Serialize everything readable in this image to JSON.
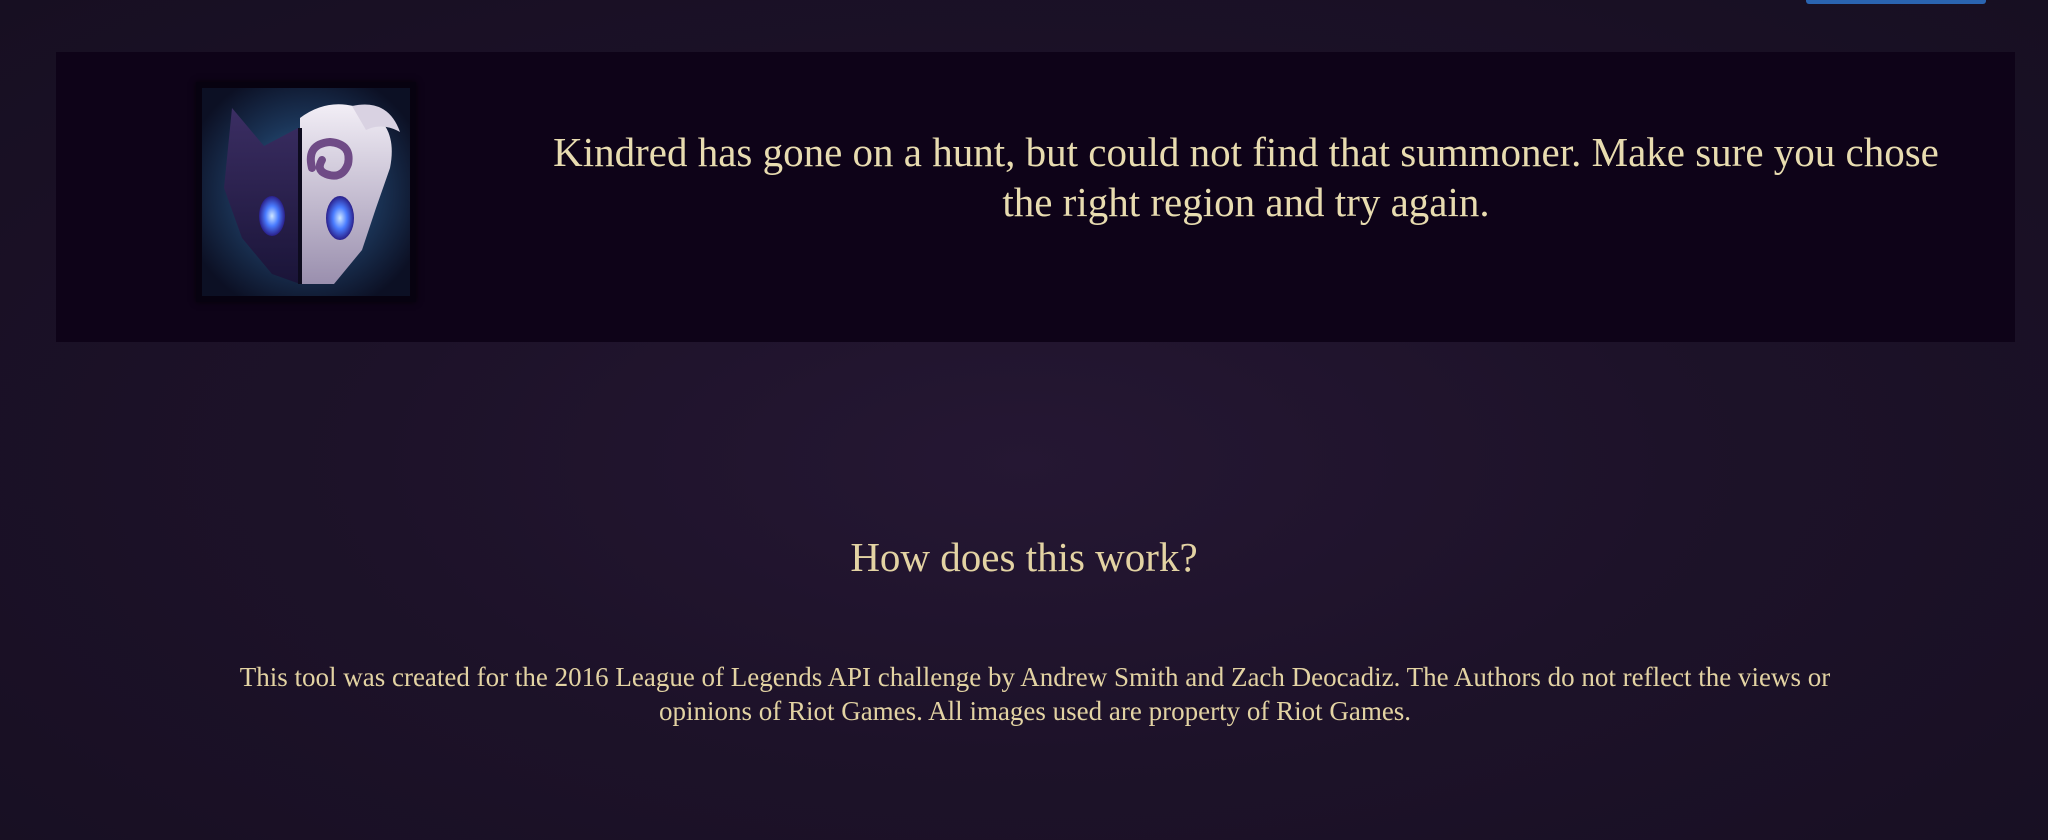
{
  "error": {
    "champion_icon": "kindred-portrait",
    "message": "Kindred has gone on a hunt, but could not find that summoner. Make sure you chose the right region and try again."
  },
  "info": {
    "title": "How does this work?",
    "description": "This tool was created for the 2016 League of Legends API challenge by Andrew Smith and Zach Deocadiz. The Authors do not reflect the views or opinions of Riot Games. All images used are property of Riot Games."
  },
  "colors": {
    "background": "#1d1229",
    "panel": "#0e0318",
    "text": "#e3d3a3",
    "button": "#2a64b0"
  }
}
